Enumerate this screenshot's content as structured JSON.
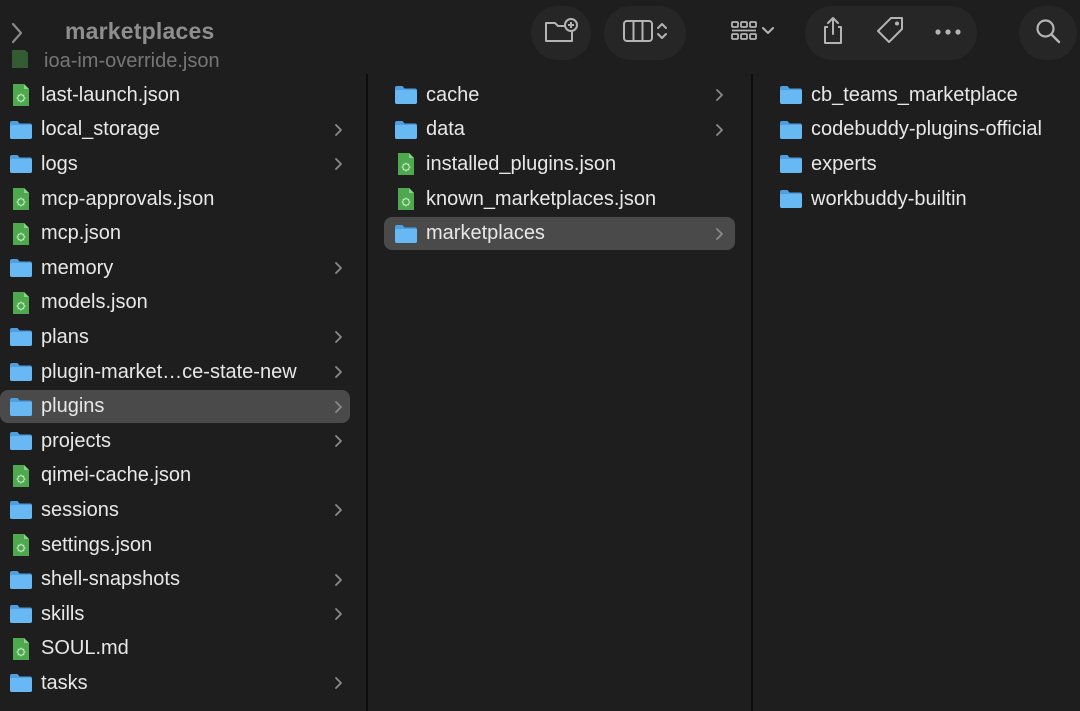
{
  "window": {
    "title": "marketplaces"
  },
  "colors": {
    "background": "#1e1e1e",
    "selection": "#4a4a4a",
    "folder": "#5aaef0",
    "json_file": "#4ea84e",
    "text": "#e8e8e8"
  },
  "toolbar": {
    "icons": [
      "back-chevron-icon",
      "new-folder-icon",
      "column-view-icon",
      "group-icon",
      "share-icon",
      "tag-icon",
      "more-icon",
      "search-icon"
    ]
  },
  "overlap_row": {
    "label": "ioa-im-override.json"
  },
  "columns": [
    {
      "items": [
        {
          "label": "last-launch.json",
          "kind": "file"
        },
        {
          "label": "local_storage",
          "kind": "folder"
        },
        {
          "label": "logs",
          "kind": "folder"
        },
        {
          "label": "mcp-approvals.json",
          "kind": "file"
        },
        {
          "label": "mcp.json",
          "kind": "file"
        },
        {
          "label": "memory",
          "kind": "folder"
        },
        {
          "label": "models.json",
          "kind": "file"
        },
        {
          "label": "plans",
          "kind": "folder"
        },
        {
          "label": "plugin-market…ce-state-new",
          "kind": "folder"
        },
        {
          "label": "plugins",
          "kind": "folder",
          "selected": true
        },
        {
          "label": "projects",
          "kind": "folder"
        },
        {
          "label": "qimei-cache.json",
          "kind": "file"
        },
        {
          "label": "sessions",
          "kind": "folder"
        },
        {
          "label": "settings.json",
          "kind": "file"
        },
        {
          "label": "shell-snapshots",
          "kind": "folder"
        },
        {
          "label": "skills",
          "kind": "folder"
        },
        {
          "label": "SOUL.md",
          "kind": "file"
        },
        {
          "label": "tasks",
          "kind": "folder"
        }
      ]
    },
    {
      "items": [
        {
          "label": "cache",
          "kind": "folder"
        },
        {
          "label": "data",
          "kind": "folder"
        },
        {
          "label": "installed_plugins.json",
          "kind": "file"
        },
        {
          "label": "known_marketplaces.json",
          "kind": "file"
        },
        {
          "label": "marketplaces",
          "kind": "folder",
          "selected": true
        }
      ]
    },
    {
      "items": [
        {
          "label": "cb_teams_marketplace",
          "kind": "folder"
        },
        {
          "label": "codebuddy-plugins-official",
          "kind": "folder"
        },
        {
          "label": "experts",
          "kind": "folder"
        },
        {
          "label": "workbuddy-builtin",
          "kind": "folder"
        }
      ]
    }
  ]
}
